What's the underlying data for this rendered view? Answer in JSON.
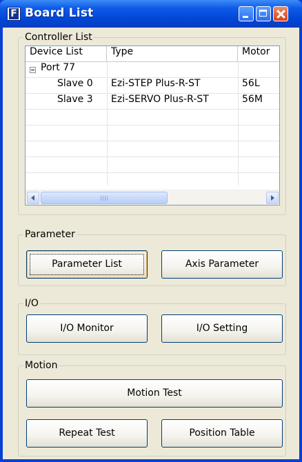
{
  "window": {
    "title": "Board List"
  },
  "controller_list": {
    "group_label": "Controller List",
    "columns": [
      "Device List",
      "Type",
      "Motor"
    ],
    "rows": [
      {
        "device": "Port 77",
        "type": "",
        "motor": ""
      },
      {
        "device": "Slave 0",
        "type": "Ezi-STEP Plus-R-ST",
        "motor": "56L"
      },
      {
        "device": "Slave 3",
        "type": "Ezi-SERVO Plus-R-ST",
        "motor": "56M"
      }
    ]
  },
  "parameter": {
    "group_label": "Parameter",
    "parameter_list_label": "Parameter List",
    "axis_parameter_label": "Axis Parameter"
  },
  "io": {
    "group_label": "I/O",
    "io_monitor_label": "I/O Monitor",
    "io_setting_label": "I/O Setting"
  },
  "motion": {
    "group_label": "Motion",
    "motion_test_label": "Motion Test",
    "repeat_test_label": "Repeat Test",
    "position_table_label": "Position Table"
  },
  "icons": {
    "app": "board-list-app-icon",
    "minimize": "minimize-icon",
    "maximize": "maximize-icon",
    "close": "close-icon",
    "tree_collapse": "minus-box-icon",
    "scroll_left": "arrow-left-icon",
    "scroll_right": "arrow-right-icon"
  },
  "colors": {
    "titlebar": "#0a4ad8",
    "client_bg": "#ece9d8",
    "button_border": "#003c74"
  }
}
